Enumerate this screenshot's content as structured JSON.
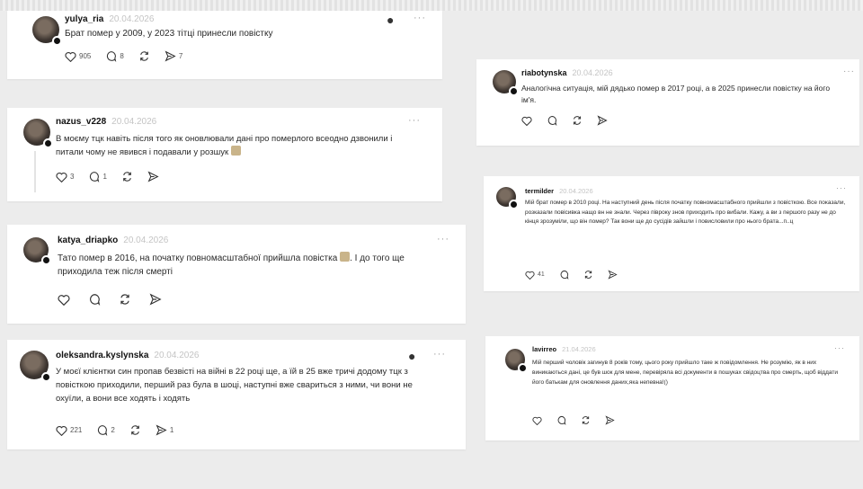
{
  "posts": [
    {
      "username": "yulya_ria",
      "date": "20.04.2026",
      "text": "Брат помер у 2009, у 2023 тітці принесли повістку",
      "likes": "905",
      "comments": "8",
      "shares": "7",
      "more": "···"
    },
    {
      "username": "nazus_v228",
      "date": "20.04.2026",
      "text": "В моєму тцк навіть після того як оновлювали дані про померлого всеодно дзвонили і питали чому не явився і подавали у розшук",
      "likes": "3",
      "comments": "1",
      "more": "···"
    },
    {
      "username": "katya_driapko",
      "date": "20.04.2026",
      "text": "Тато помер в 2016, на початку повномасштабної прийшла повістка",
      "text2": ". І до того ще приходила теж після смерті",
      "more": "···"
    },
    {
      "username": "oleksandra.kyslynska",
      "date": "20.04.2026",
      "text": "У моєї клієнтки син пропав безвісті на війні в 22 році ще, а їй в 25 вже тричі додому тцк з повісткою приходили, перший раз була в шоці, наступні вже свариться з ними, чи вони не охуїли, а вони все ходять і ходять",
      "likes": "221",
      "comments": "2",
      "shares": "1",
      "more": "···"
    },
    {
      "username": "riabotynska",
      "date": "20.04.2026",
      "text": "Аналогічна ситуація, мій дядько помер в 2017 році, а в 2025 принесли повістку на його ім'я.",
      "more": "···"
    },
    {
      "username": "termilder",
      "date": "20.04.2026",
      "text": "Мій брат помер в 2010 році. На наступний день після початку повномасштабного прийшли з повісткою. Все показали, розказали повісивка нащо вн не знали. Через півроку знов приходить про вибали. Кажу, а ви з першого разу не до кінця зрозуміли, що він помер? Так вони ще до сусідів зайшли і повисловили про нього брата...п..ц",
      "likes": "41",
      "more": "···"
    },
    {
      "username": "lavirreo",
      "date": "21.04.2026",
      "text": "Мій перший чоловік загинув 8 років тому, цього року прийшло таке ж повідомлення. Не розумію, як в них виникаються дані, це був шок для мене, перевіряла всі документи в пошуках свідоцтва про смерть, щоб віддати його батькам для оновлення даних,яка непевна!()",
      "more": "···"
    }
  ]
}
